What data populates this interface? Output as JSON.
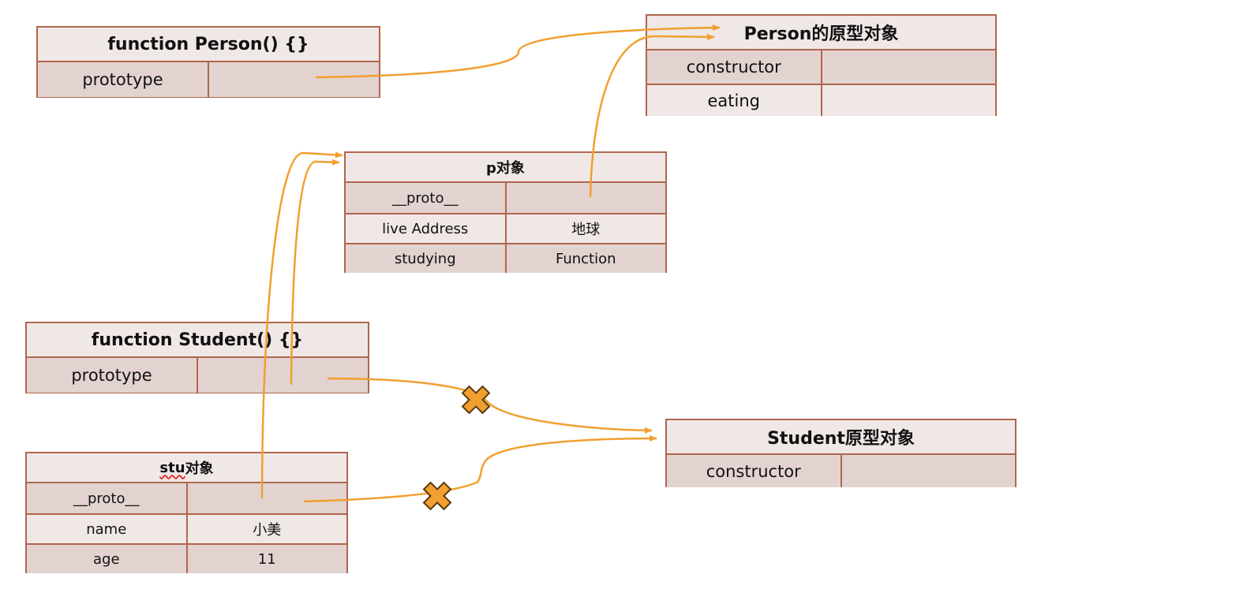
{
  "person_fn": {
    "title": "function Person() {}",
    "rows": [
      {
        "label": "prototype",
        "value": ""
      }
    ]
  },
  "person_proto": {
    "title": "Person的原型对象",
    "rows": [
      {
        "label": "constructor",
        "value": ""
      },
      {
        "label": "eating",
        "value": ""
      }
    ]
  },
  "p_obj": {
    "title": "p对象",
    "rows": [
      {
        "label": "__proto__",
        "value": ""
      },
      {
        "label": "live Address",
        "value": "地球"
      },
      {
        "label": "studying",
        "value": "Function"
      }
    ]
  },
  "student_fn": {
    "title": "function Student() {}",
    "rows": [
      {
        "label": "prototype",
        "value": ""
      }
    ]
  },
  "student_proto": {
    "title": "Student原型对象",
    "rows": [
      {
        "label": "constructor",
        "value": ""
      }
    ]
  },
  "stu_obj": {
    "title_prefix": "stu",
    "title_suffix": "对象",
    "rows": [
      {
        "label": "__proto__",
        "value": ""
      },
      {
        "label": "name",
        "value": "小美"
      },
      {
        "label": "age",
        "value": "11"
      }
    ]
  },
  "colors": {
    "arrow": "#f0a030",
    "border": "#b0664e",
    "cell_dark": "#e2d3d0",
    "cell_light": "#f0e8e6",
    "cross_fill": "#f0a030",
    "cross_stroke": "#5a3a10"
  },
  "icons": {
    "broken_link": "x-cross-icon"
  }
}
